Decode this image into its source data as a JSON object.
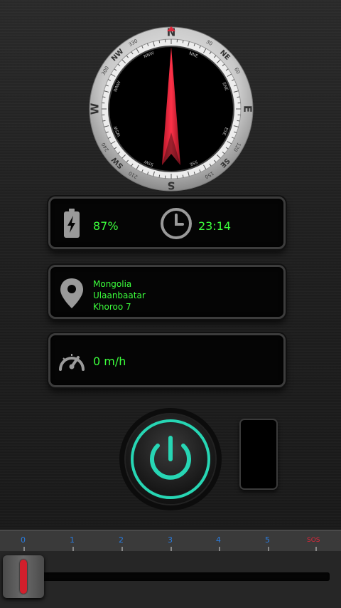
{
  "compass": {
    "labels": [
      "N",
      "NE",
      "E",
      "SE",
      "S",
      "SW",
      "W",
      "NW"
    ],
    "degrees": [
      "330",
      "30",
      "60",
      "120",
      "150",
      "210",
      "240",
      "300"
    ],
    "minor": [
      "NNE",
      "ENE",
      "ESE",
      "SSE",
      "SSW",
      "WSW",
      "WNW",
      "NNW"
    ],
    "needle_color": "#e0263a"
  },
  "status": {
    "battery": "87%",
    "time": "23:14"
  },
  "location": {
    "line1": "Mongolia",
    "line2": "Ulaanbaatar",
    "line3": "Khoroo 7"
  },
  "speed": {
    "value": "0 m/h"
  },
  "scale": {
    "ticks": [
      "0",
      "1",
      "2",
      "3",
      "4",
      "5",
      "SOS"
    ]
  },
  "slider": {
    "level": 0
  },
  "colors": {
    "accent": "#3cff3c",
    "power_ring": "#27d6b4",
    "sos": "#e0263a",
    "tick": "#2a7de1"
  }
}
